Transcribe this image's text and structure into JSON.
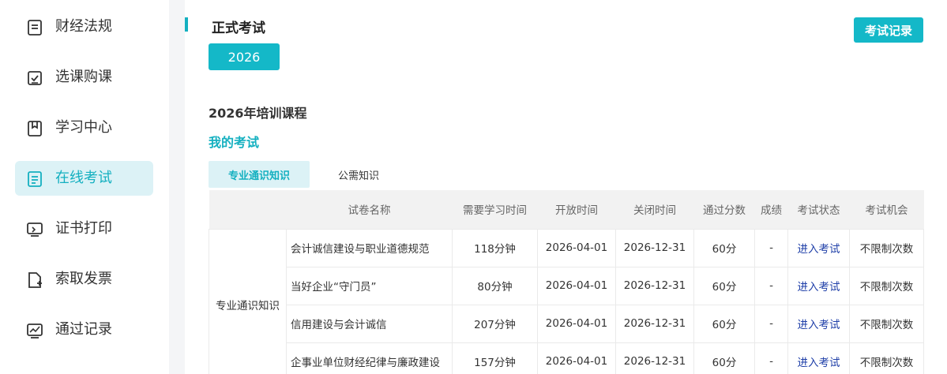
{
  "sidebar": {
    "items": [
      {
        "label": "财经法规",
        "icon": "document-icon",
        "active": false
      },
      {
        "label": "选课购课",
        "icon": "checkbox-icon",
        "active": false
      },
      {
        "label": "学习中心",
        "icon": "book-icon",
        "active": false
      },
      {
        "label": "在线考试",
        "icon": "exam-paper-icon",
        "active": true
      },
      {
        "label": "证书打印",
        "icon": "monitor-print-icon",
        "active": false
      },
      {
        "label": "索取发票",
        "icon": "invoice-add-icon",
        "active": false
      },
      {
        "label": "通过记录",
        "icon": "chart-icon",
        "active": false
      }
    ]
  },
  "main": {
    "title": "正式考试",
    "year_button": "2026",
    "record_button": "考试记录",
    "section_title": "2026年培训课程",
    "my_exam": "我的考试",
    "tabs": [
      {
        "label": "专业通识知识",
        "active": true
      },
      {
        "label": "公需知识",
        "active": false
      }
    ]
  },
  "table": {
    "headers": [
      "",
      "试卷名称",
      "需要学习时间",
      "开放时间",
      "关闭时间",
      "通过分数",
      "成绩",
      "考试状态",
      "考试机会"
    ],
    "group": "专业通识知识",
    "rows": [
      {
        "name": "会计诚信建设与职业道德规范",
        "study_time": "118分钟",
        "open": "2026-04-01",
        "close": "2026-12-31",
        "pass": "60分",
        "score": "-",
        "status": "进入考试",
        "chances": "不限制次数"
      },
      {
        "name": "当好企业“守门员”",
        "study_time": "80分钟",
        "open": "2026-04-01",
        "close": "2026-12-31",
        "pass": "60分",
        "score": "-",
        "status": "进入考试",
        "chances": "不限制次数"
      },
      {
        "name": "信用建设与会计诚信",
        "study_time": "207分钟",
        "open": "2026-04-01",
        "close": "2026-12-31",
        "pass": "60分",
        "score": "-",
        "status": "进入考试",
        "chances": "不限制次数"
      },
      {
        "name": "企事业单位财经纪律与廉政建设",
        "study_time": "157分钟",
        "open": "2026-04-01",
        "close": "2026-12-31",
        "pass": "60分",
        "score": "-",
        "status": "进入考试",
        "chances": "不限制次数"
      }
    ]
  },
  "colors": {
    "accent": "#14b8c8",
    "link": "#1f3fa8",
    "active_bg": "#dcf2f6"
  }
}
